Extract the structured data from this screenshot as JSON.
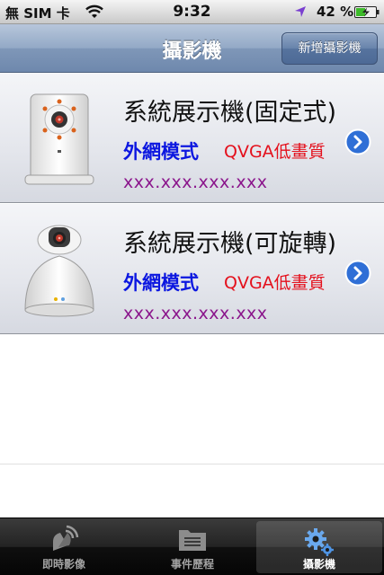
{
  "status_bar": {
    "carrier": "無 SIM 卡",
    "time": "9:32",
    "battery": "42 %"
  },
  "nav_bar": {
    "title": "攝影機",
    "add_button_label": "新增攝影機"
  },
  "cameras": [
    {
      "name": "系統展示機(固定式)",
      "mode": "外網模式",
      "quality": "QVGA低畫質",
      "ip": "xxx.xxx.xxx.xxx",
      "icon": "fixed-camera-icon"
    },
    {
      "name": "系統展示機(可旋轉)",
      "mode": "外網模式",
      "quality": "QVGA低畫質",
      "ip": "xxx.xxx.xxx.xxx",
      "icon": "pan-tilt-camera-icon"
    }
  ],
  "tab_bar": {
    "tabs": [
      {
        "label": "即時影像",
        "icon": "live-video-icon",
        "selected": false
      },
      {
        "label": "事件歷程",
        "icon": "folder-icon",
        "selected": false
      },
      {
        "label": "攝影機",
        "icon": "gears-icon",
        "selected": true
      }
    ]
  },
  "colors": {
    "mode_text": "#0c17e0",
    "quality_text": "#e4101c",
    "ip_text": "#8b168c",
    "nav_bar": "#7f97b8"
  }
}
